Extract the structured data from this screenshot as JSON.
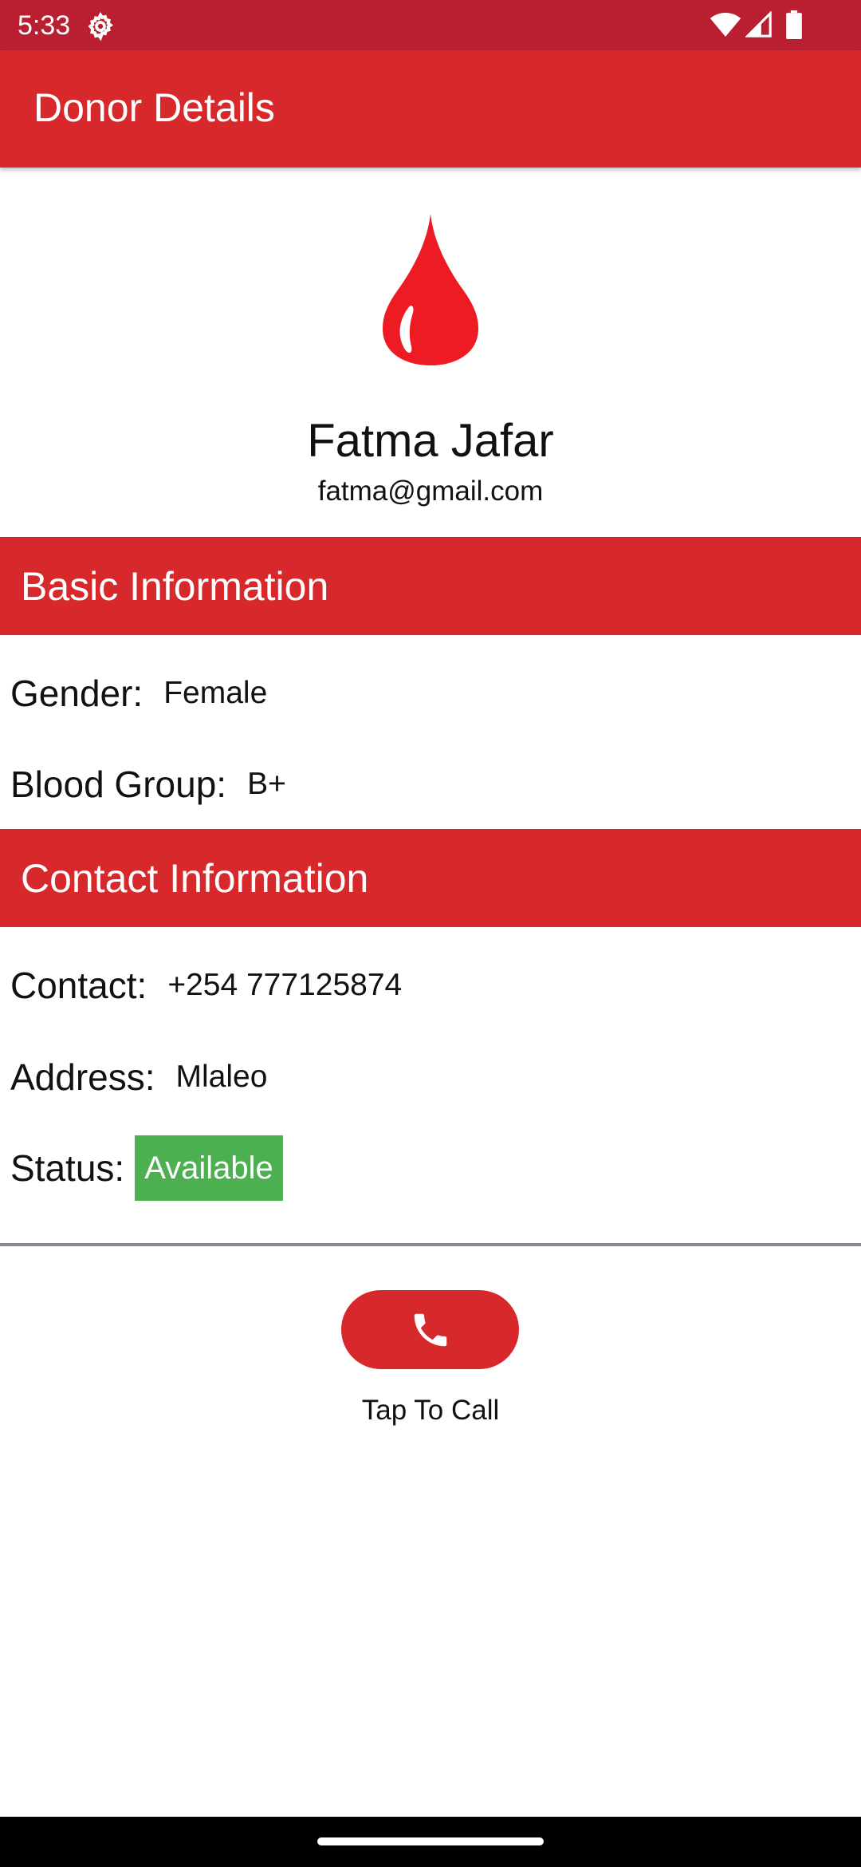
{
  "status_bar": {
    "time": "5:33",
    "background_color": "#b91f31",
    "icons": [
      "gear-icon",
      "wifi-icon",
      "signal-icon",
      "battery-icon"
    ]
  },
  "app_bar": {
    "title": "Donor Details",
    "color": "#d7282b"
  },
  "profile": {
    "icon": "blood-drop-icon",
    "icon_color": "#ed1c24",
    "name": "Fatma Jafar",
    "email": "fatma@gmail.com"
  },
  "basic_info": {
    "title": "Basic Information",
    "gender_label": "Gender:",
    "gender_value": "Female",
    "blood_group_label": "Blood Group:",
    "blood_group_value": "B+"
  },
  "contact_info": {
    "title": "Contact Information",
    "contact_label": "Contact:",
    "contact_value": "+254 777125874",
    "address_label": "Address:",
    "address_value": "Mlaleo",
    "status_label": "Status:",
    "status_value": "Available",
    "status_color": "#4caf50"
  },
  "call": {
    "icon": "phone-icon",
    "caption": "Tap To Call"
  }
}
